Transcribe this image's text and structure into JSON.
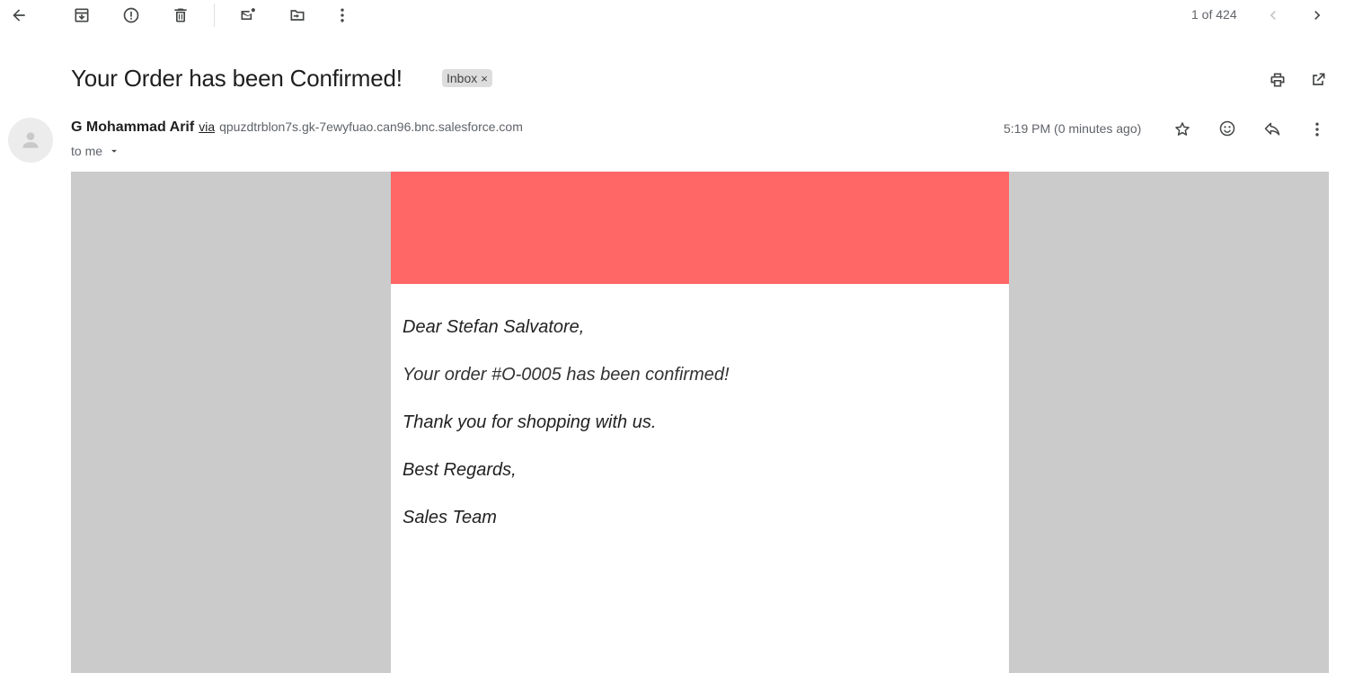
{
  "toolbar": {
    "pager_text": "1 of 424"
  },
  "message": {
    "subject": "Your Order has been Confirmed!",
    "label": "Inbox",
    "label_remove": "×",
    "sender_name": "G Mohammad Arif",
    "via_text": "via",
    "sender_address": "qpuzdtrblon7s.gk-7ewyfuao.can96.bnc.salesforce.com",
    "recipient": "to me",
    "time": "5:19 PM (0 minutes ago)"
  },
  "email_body": {
    "greeting": "Dear Stefan Salvatore,",
    "confirmation": "Your order #O-0005 has been confirmed!",
    "thanks": "Thank you for shopping with us.",
    "closing": "Best Regards,",
    "signature": "Sales Team"
  },
  "colors": {
    "banner": "#ff6666",
    "frame": "#cbcbcb",
    "icon": "#444746"
  }
}
